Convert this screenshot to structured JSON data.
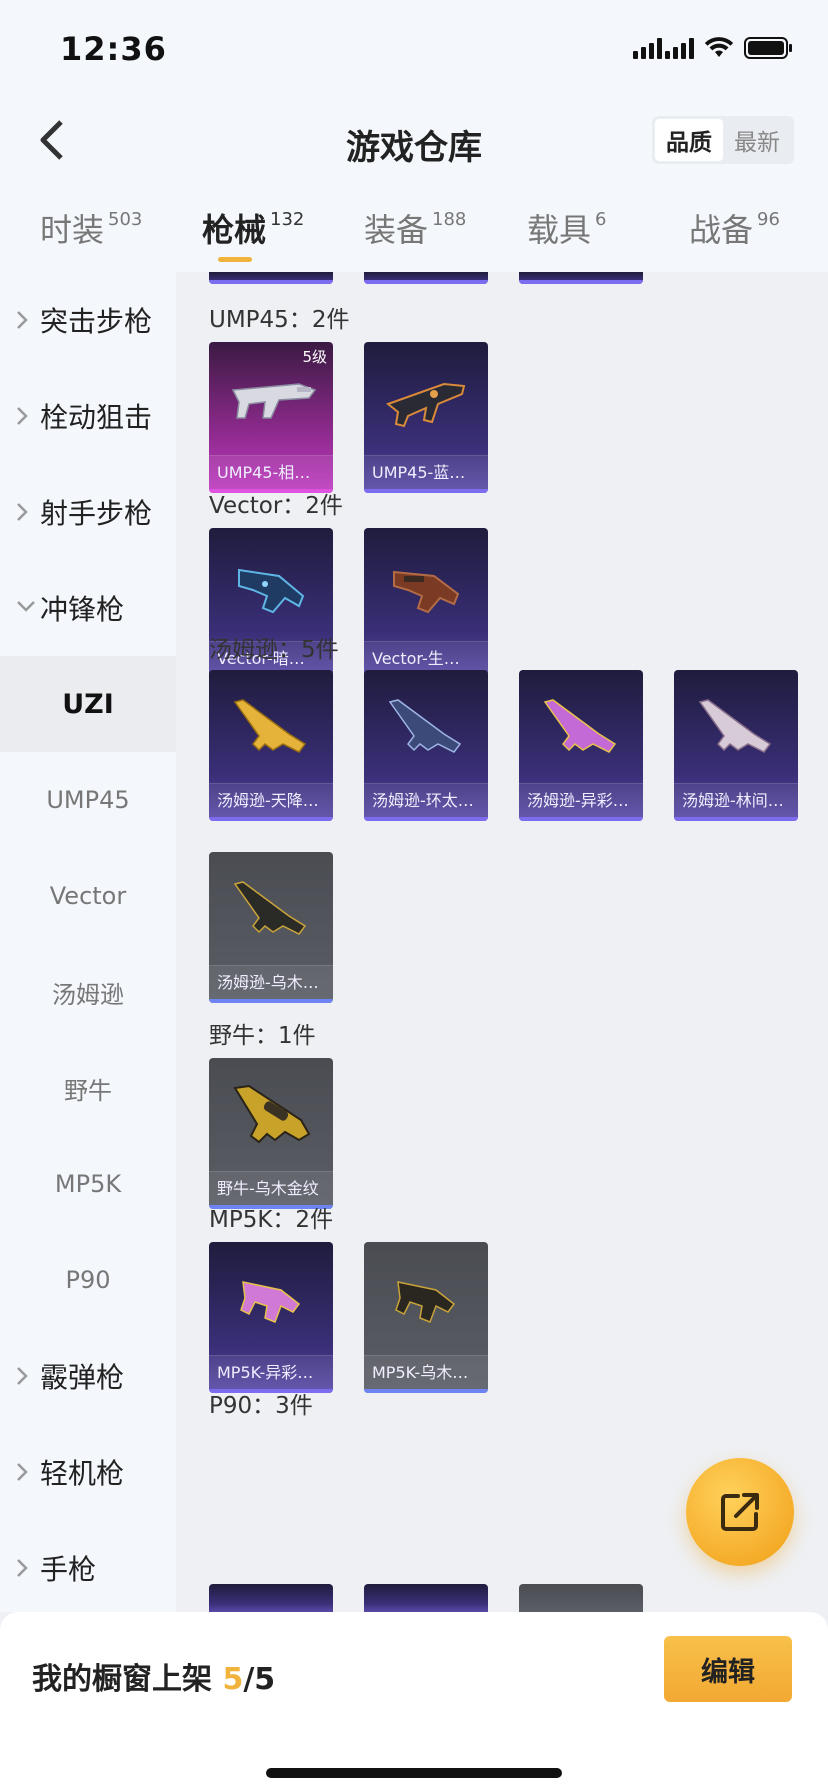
{
  "status": {
    "time": "12:36"
  },
  "nav": {
    "title": "游戏仓库",
    "sort_options": [
      "品质",
      "最新"
    ]
  },
  "tabs": [
    {
      "label": "时装",
      "count": "503"
    },
    {
      "label": "枪械",
      "count": "132"
    },
    {
      "label": "装备",
      "count": "188"
    },
    {
      "label": "载具",
      "count": "6"
    },
    {
      "label": "战备",
      "count": "96"
    }
  ],
  "sidebar": {
    "groups_top": [
      "突击步枪",
      "栓动狙击",
      "射手步枪",
      "冲锋枪"
    ],
    "subitems": [
      "UZI",
      "UMP45",
      "Vector",
      "汤姆逊",
      "野牛",
      "MP5K",
      "P90"
    ],
    "groups_bottom": [
      "霰弹枪",
      "轻机枪",
      "手枪"
    ]
  },
  "sections": [
    {
      "title": "UMP45：2件",
      "items": [
        {
          "name": "UMP45-相…",
          "level": "5级"
        },
        {
          "name": "UMP45-蓝…"
        }
      ]
    },
    {
      "title": "Vector：2件",
      "items": [
        {
          "name": "Vector-暗…"
        },
        {
          "name": "Vector-生…"
        }
      ]
    },
    {
      "title": "汤姆逊：5件",
      "items": [
        {
          "name": "汤姆逊-天降…"
        },
        {
          "name": "汤姆逊-环太…"
        },
        {
          "name": "汤姆逊-异彩…"
        },
        {
          "name": "汤姆逊-林间…"
        },
        {
          "name": "汤姆逊-乌木…"
        }
      ]
    },
    {
      "title": "野牛：1件",
      "items": [
        {
          "name": "野牛-乌木金纹"
        }
      ]
    },
    {
      "title": "MP5K：2件",
      "items": [
        {
          "name": "MP5K-异彩…"
        },
        {
          "name": "MP5K-乌木…"
        }
      ]
    },
    {
      "title": "P90：3件",
      "items": []
    }
  ],
  "bottom": {
    "shelf_prefix": "我的橱窗上架 ",
    "shelf_used": "5",
    "shelf_total": "/5",
    "edit_label": "编辑"
  },
  "colors": {
    "accent": "#f2b33d",
    "rarity_purple": "#7c6cf0",
    "rarity_pink": "#e052e0",
    "rarity_gray": "#6f84f4"
  }
}
